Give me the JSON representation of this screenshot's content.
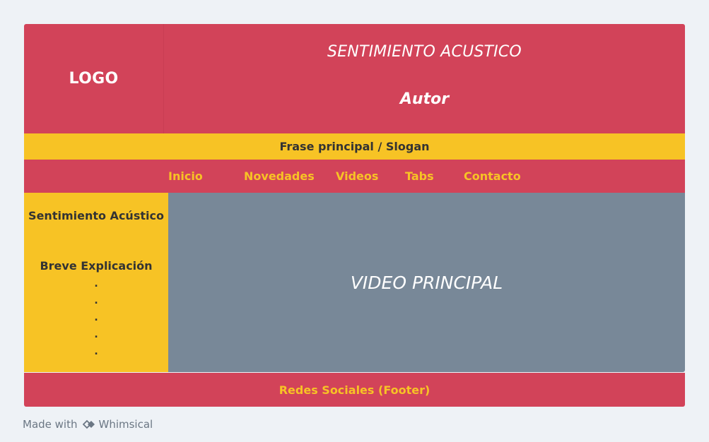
{
  "header": {
    "logo": "LOGO",
    "title": "SENTIMIENTO ACUSTICO",
    "author": "Autor"
  },
  "slogan": "Frase principal / Slogan",
  "nav": {
    "items": [
      {
        "label": "Inicio"
      },
      {
        "label": "Novedades"
      },
      {
        "label": "Videos"
      },
      {
        "label": "Tabs"
      },
      {
        "label": "Contacto"
      }
    ]
  },
  "sidebar": {
    "title": "Sentimiento Acústico",
    "text": "Breve Explicación",
    "dots": [
      ".",
      ".",
      ".",
      ".",
      "."
    ]
  },
  "main": {
    "video_label": "VIDEO PRINCIPAL"
  },
  "footer": {
    "label": "Redes Sociales (Footer)"
  },
  "credit": {
    "prefix": "Made with",
    "brand": "Whimsical",
    "icon": "whimsical-logo-icon"
  },
  "colors": {
    "red": "#d24359",
    "yellow": "#f7c325",
    "gray": "#788898",
    "background": "#eef2f6"
  }
}
